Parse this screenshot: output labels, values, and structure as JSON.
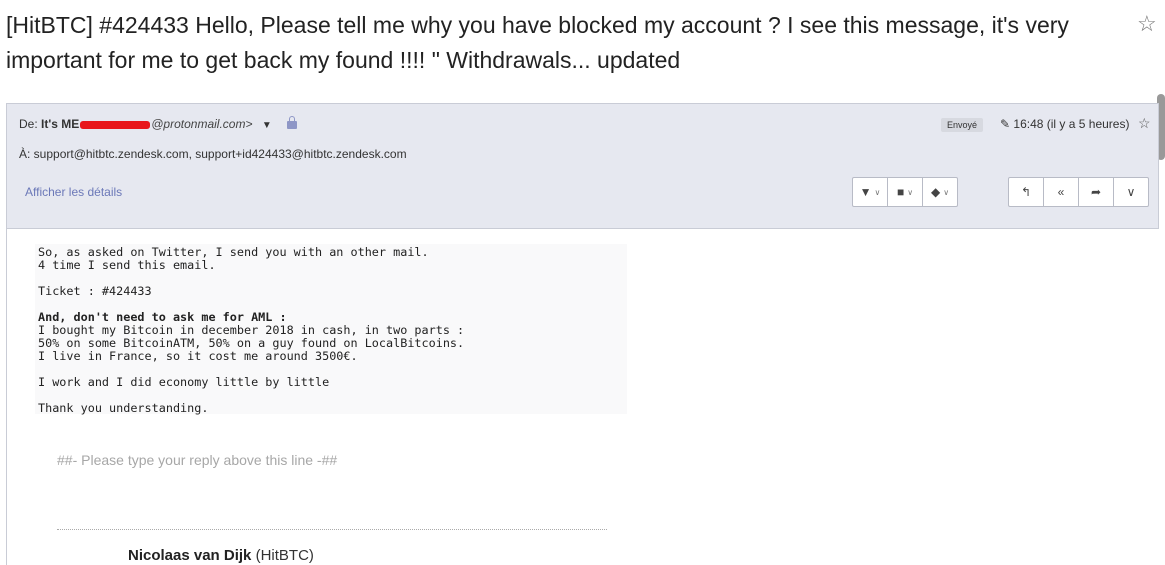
{
  "subject": "[HitBTC] #424433 Hello, Please tell me why you have blocked my account ? I see this message, it's very important for me to get back my found !!!! \" Withdrawals... updated",
  "header": {
    "from_prefix": "De:",
    "from_name": "It's ME",
    "from_email_suffix": "@protonmail.com>",
    "to_line": "À: support@hitbtc.zendesk.com, support+id424433@hitbtc.zendesk.com",
    "details_link": "Afficher les détails",
    "sent_badge": "Envoyé",
    "time": "16:48 (il y a 5 heures)"
  },
  "toolbar": {
    "filter_icon": "filter-icon",
    "folder_icon": "folder-icon",
    "label_icon": "tag-icon",
    "reply_icon": "reply-icon",
    "reply_all_icon": "reply-all-icon",
    "forward_icon": "forward-icon",
    "more_icon": "chevron-down-icon"
  },
  "body": {
    "l1": "So, as asked on Twitter, I send you with an other mail.",
    "l2": "4 time I send this email.",
    "l3": "Ticket : #424433",
    "l4": "And, don't need to ask me for AML :",
    "l5": "I bought my Bitcoin in december 2018 in cash, in two parts :",
    "l6": "50% on some BitcoinATM, 50% on a guy found on LocalBitcoins.",
    "l7": "I live in France, so it cost me around 3500€.",
    "l8": "I work and I did economy little by little",
    "l9": "Thank you understanding."
  },
  "reply_marker": "##- Please type your reply above this line -##",
  "signature": {
    "name": "Nicolaas van Dijk",
    "org": "(HitBTC)"
  },
  "colors": {
    "header_bg": "#e6e8f0",
    "link": "#6b78b8",
    "redaction": "#e8161b"
  }
}
